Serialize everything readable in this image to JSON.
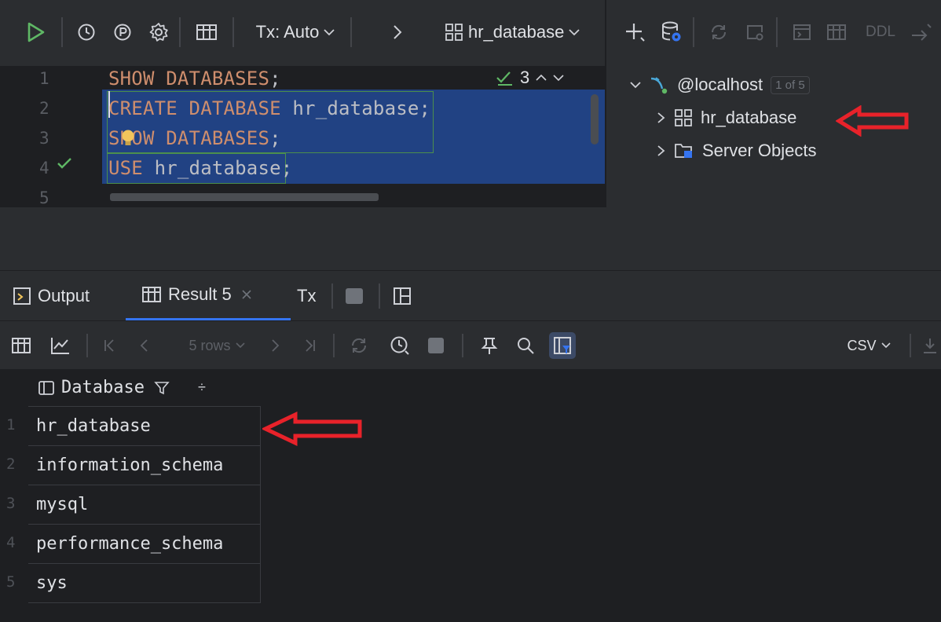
{
  "toolbar": {
    "tx_mode": "Tx: Auto",
    "schema": "hr_database",
    "ddl_label": "DDL"
  },
  "editor": {
    "lines": [
      {
        "num": "1",
        "parts": [
          {
            "t": "SHOW DATABASES",
            "c": "kw"
          },
          {
            "t": ";",
            "c": "id"
          }
        ]
      },
      {
        "num": "2",
        "parts": [
          {
            "t": "CREATE DATABASE ",
            "c": "kw"
          },
          {
            "t": "hr_database",
            "c": "id"
          },
          {
            "t": ";",
            "c": "id"
          }
        ]
      },
      {
        "num": "3",
        "parts": [
          {
            "t": "SHOW DATABASES",
            "c": "kw"
          },
          {
            "t": ";",
            "c": "id"
          }
        ]
      },
      {
        "num": "4",
        "parts": [
          {
            "t": "USE ",
            "c": "kw"
          },
          {
            "t": "hr_database",
            "c": "id"
          },
          {
            "t": ";",
            "c": "id"
          }
        ]
      },
      {
        "num": "5",
        "parts": []
      }
    ],
    "inspection_count": "3"
  },
  "tree": {
    "host": "@localhost",
    "host_badge": "1 of 5",
    "items": [
      {
        "label": "hr_database"
      },
      {
        "label": "Server Objects"
      }
    ]
  },
  "tabs": {
    "output": "Output",
    "result": "Result 5",
    "tx": "Tx"
  },
  "results_toolbar": {
    "rows": "5 rows",
    "export": "CSV"
  },
  "grid": {
    "column": "Database",
    "rows": [
      {
        "num": "1",
        "value": "hr_database"
      },
      {
        "num": "2",
        "value": "information_schema"
      },
      {
        "num": "3",
        "value": "mysql"
      },
      {
        "num": "4",
        "value": "performance_schema"
      },
      {
        "num": "5",
        "value": "sys"
      }
    ]
  },
  "colors": {
    "accent": "#4b8f4b",
    "keyword": "#cf8e6d",
    "selection": "#214283",
    "annotation": "#e8222a"
  }
}
